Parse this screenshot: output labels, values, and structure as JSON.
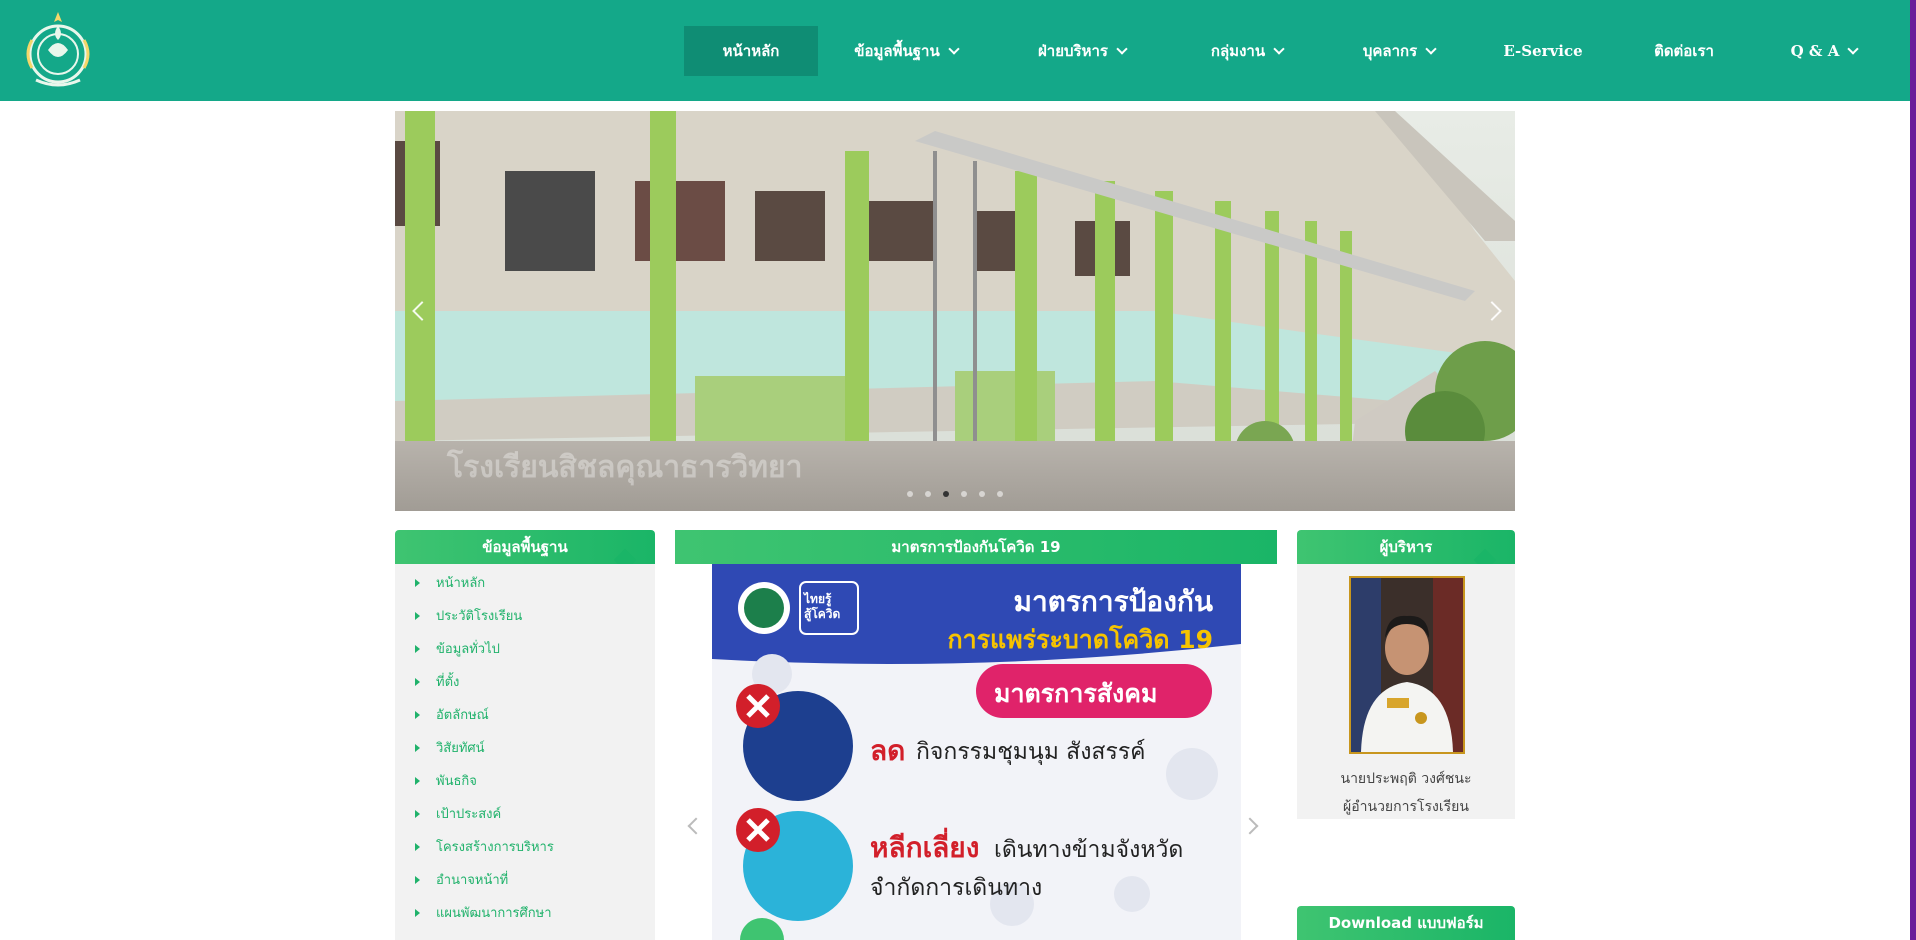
{
  "nav": {
    "logo_icon": "school-emblem-icon",
    "items": [
      {
        "label": "หน้าหลัก",
        "dropdown": false,
        "active": true
      },
      {
        "label": "ข้อมูลพื้นฐาน",
        "dropdown": true,
        "active": false
      },
      {
        "label": "ฝ่ายบริหาร",
        "dropdown": true,
        "active": false
      },
      {
        "label": "กลุ่มงาน",
        "dropdown": true,
        "active": false
      },
      {
        "label": "บุคลากร",
        "dropdown": true,
        "active": false
      },
      {
        "label": "E-Service",
        "dropdown": false,
        "active": false
      },
      {
        "label": "ติดต่อเรา",
        "dropdown": false,
        "active": false
      },
      {
        "label": "Q & A",
        "dropdown": true,
        "active": false
      }
    ]
  },
  "hero": {
    "caption": "โรงเรียนสิชลคุณาธารวิทยา",
    "slide_count": 6,
    "active_slide": 3
  },
  "left_panel": {
    "title": "ข้อมูลพื้นฐาน",
    "items": [
      "หน้าหลัก",
      "ประวัติโรงเรียน",
      "ข้อมูลทั่วไป",
      "ที่ตั้ง",
      "อัตลักษณ์",
      "วิสัยทัศน์",
      "พันธกิจ",
      "เป้าประสงค์",
      "โครงสร้างการบริหาร",
      "อำนาจหน้าที่",
      "แผนพัฒนาการศึกษา"
    ]
  },
  "center_panel": {
    "title": "มาตรการป้องกันโควิด 19",
    "poster": {
      "badge": "ไทยรู้\nสู้โควิด",
      "headline1": "มาตรการป้องกัน",
      "headline2": "การแพร่ระบาดโควิด 19",
      "pill": "มาตรการสังคม",
      "row1_highlight": "ลด",
      "row1_text": "กิจกรรมชุมนุม สังสรรค์",
      "row2_highlight": "หลีกเลี่ยง",
      "row2_text": "เดินทางข้ามจังหวัด",
      "row2_text2": "จำกัดการเดินทาง"
    }
  },
  "right_panel": {
    "title": "ผู้บริหาร",
    "name": "นายประพฤติ วงศ์ชนะ",
    "position": "ผู้อำนวยการโรงเรียน"
  },
  "download_panel": {
    "title": "Download แบบฟอร์ม"
  },
  "colors": {
    "nav_bg": "#14a889",
    "nav_active": "#0f8d74",
    "panel_green": "#1ab567",
    "link_green": "#20b26b",
    "poster_blue": "#2f49b4",
    "poster_yellow": "#f6c300",
    "poster_pink": "#e0236a",
    "poster_red": "#d21f2a"
  }
}
